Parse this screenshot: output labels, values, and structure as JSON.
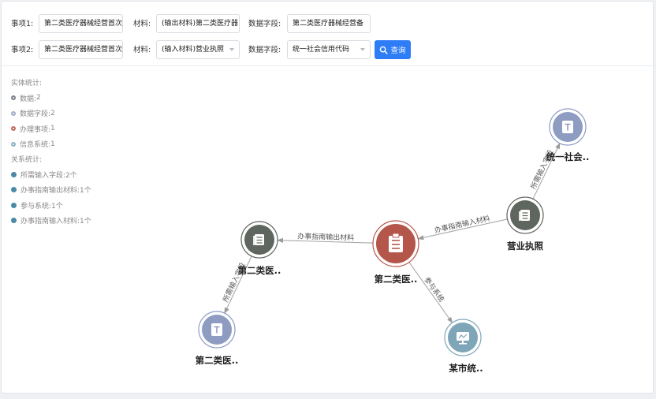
{
  "filters": {
    "row1": {
      "item_label": "事项1:",
      "item_value": "第二类医疗器械经营首次",
      "material_label": "材料:",
      "material_value": "(输出材料)第二类医疗器",
      "field_label": "数据字段:",
      "field_value": "第二类医疗器械经营备"
    },
    "row2": {
      "item_label": "事项2:",
      "item_value": "第二类医疗器械经营首次",
      "material_label": "材料:",
      "material_value": "(输入材料)营业执照",
      "field_label": "数据字段:",
      "field_value": "统一社会信用代码"
    },
    "query_label": "查询"
  },
  "stats": {
    "entity_title": "实体统计:",
    "entities": [
      {
        "label": "数据:",
        "count": "2",
        "color": "#7a7f87",
        "ring": true
      },
      {
        "label": "数据字段:",
        "count": "2",
        "color": "#a3acc4",
        "ring": true
      },
      {
        "label": "办理事项:",
        "count": "1",
        "color": "#c06a5c",
        "ring": true
      },
      {
        "label": "信息系统:",
        "count": "1",
        "color": "#8fb2c4",
        "ring": true
      }
    ],
    "relation_title": "关系统计:",
    "relations": [
      {
        "label": "所需输入字段:",
        "count": "2个",
        "color": "#4a8aa8"
      },
      {
        "label": "办事指南输出材料:",
        "count": "1个",
        "color": "#4a8aa8"
      },
      {
        "label": "参与系统:",
        "count": "1个",
        "color": "#4a8aa8"
      },
      {
        "label": "办事指南输入材料:",
        "count": "1个",
        "color": "#4a8aa8"
      }
    ]
  },
  "graph": {
    "nodes": [
      {
        "id": "center",
        "label": "第二类医..",
        "kind": "affair",
        "icon": "clipboard-icon",
        "color": "#b5564a"
      },
      {
        "id": "out_material",
        "label": "第二类医..",
        "kind": "data",
        "icon": "document-icon",
        "color": "#5f665f"
      },
      {
        "id": "out_field",
        "label": "第二类医..",
        "kind": "field",
        "icon": "text-field-icon",
        "color": "#8e9cc2"
      },
      {
        "id": "license",
        "label": "营业执照",
        "kind": "data",
        "icon": "document-icon",
        "color": "#5f665f"
      },
      {
        "id": "credit_code",
        "label": "统一社会..",
        "kind": "field",
        "icon": "text-field-icon",
        "color": "#8e9cc2"
      },
      {
        "id": "system",
        "label": "某市统..",
        "kind": "system",
        "icon": "monitor-icon",
        "color": "#7ea6b8"
      }
    ],
    "edges": [
      {
        "from": "center",
        "to": "out_material",
        "label": "办事指南输出材料"
      },
      {
        "from": "out_material",
        "to": "out_field",
        "label": "所需输入字段"
      },
      {
        "from": "license",
        "to": "center",
        "label": "办事指南输入材料"
      },
      {
        "from": "license",
        "to": "credit_code",
        "label": "所需输入字段"
      },
      {
        "from": "center",
        "to": "system",
        "label": "参与系统"
      }
    ]
  }
}
